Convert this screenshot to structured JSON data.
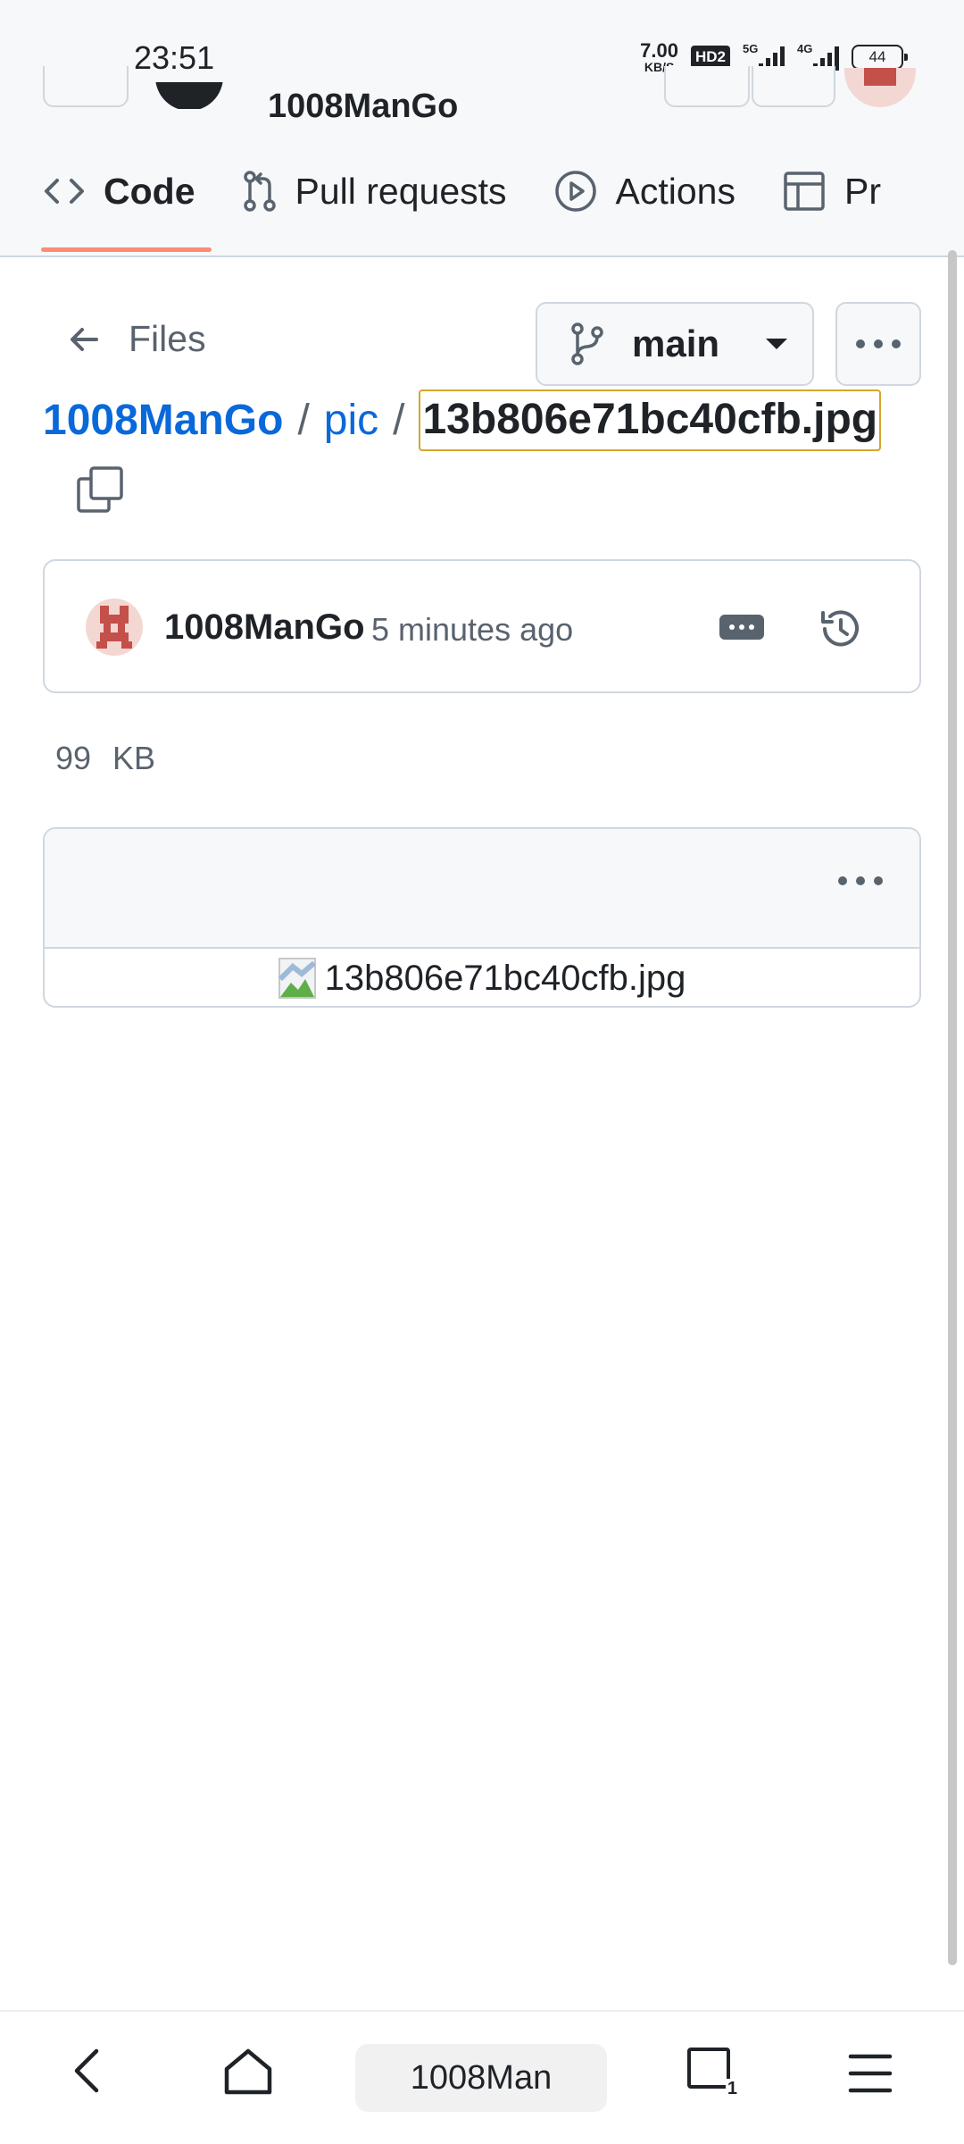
{
  "status_bar": {
    "time": "23:51",
    "net_speed_value": "7.00",
    "net_speed_unit": "KB/S",
    "hd_label": "HD2",
    "signal_1_label": "5G",
    "signal_2_label": "4G",
    "battery": "44"
  },
  "header": {
    "repo_owner": "1008ManGo"
  },
  "tabs": [
    {
      "label": "Code",
      "icon": "code-icon",
      "active": true
    },
    {
      "label": "Pull requests",
      "icon": "pull-request-icon",
      "active": false
    },
    {
      "label": "Actions",
      "icon": "play-circle-icon",
      "active": false
    },
    {
      "label": "Pr",
      "icon": "table-icon",
      "active": false
    }
  ],
  "file_header": {
    "back_label": "Files",
    "branch": "main"
  },
  "breadcrumb": {
    "repo": "1008ManGo",
    "folder": "pic",
    "file": "13b806e71bc40cfb.jpg",
    "separator": "/"
  },
  "commit": {
    "author": "1008ManGo",
    "time": "5 minutes ago"
  },
  "file_info": {
    "size": "99 KB"
  },
  "preview": {
    "alt_text": "13b806e71bc40cfb.jpg"
  },
  "browser_bar": {
    "url_text": "1008Man",
    "tab_count": "1"
  },
  "colors": {
    "link": "#0969da",
    "tab_underline": "#fd8c73",
    "highlight_border": "#d4a72c",
    "muted": "#59636e"
  }
}
